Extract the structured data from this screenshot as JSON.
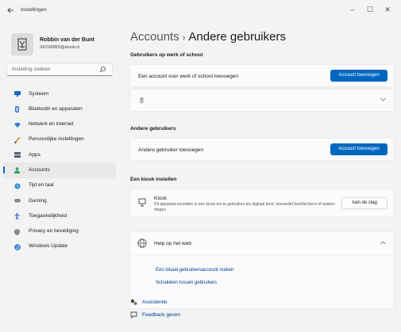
{
  "window": {
    "title": "Instellingen",
    "back_icon": "back-arrow-icon",
    "controls": [
      "–",
      "☐",
      "✕"
    ]
  },
  "profile": {
    "name": "Robbin van der Bunt",
    "email": "SKVSRI800@skvob.nl"
  },
  "search": {
    "placeholder": "Instelling zoeken"
  },
  "sidebar": {
    "items": [
      {
        "label": "Systeem",
        "icon": "monitor-icon",
        "color": "#0f6cbd"
      },
      {
        "label": "Bluetooth en apparaten",
        "icon": "bluetooth-icon",
        "color": "#1f6fd1"
      },
      {
        "label": "Netwerk en internet",
        "icon": "wifi-icon",
        "color": "#2b7bd3"
      },
      {
        "label": "Persoonlijke instellingen",
        "icon": "brush-icon",
        "color": "#e48a2f"
      },
      {
        "label": "Apps",
        "icon": "apps-icon",
        "color": "#52617a"
      },
      {
        "label": "Accounts",
        "icon": "person-icon",
        "color": "#2aa15a",
        "active": true
      },
      {
        "label": "Tijd en taal",
        "icon": "globe-clock-icon",
        "color": "#2d8fd6"
      },
      {
        "label": "Gaming",
        "icon": "gamepad-icon",
        "color": "#8a8a8a"
      },
      {
        "label": "Toegankelijkheid",
        "icon": "accessibility-icon",
        "color": "#1d5fb8"
      },
      {
        "label": "Privacy en beveiliging",
        "icon": "shield-icon",
        "color": "#8c8c8c"
      },
      {
        "label": "Windows Update",
        "icon": "update-icon",
        "color": "#1f78d1"
      }
    ]
  },
  "main": {
    "breadcrumb_parent": "Accounts",
    "breadcrumb_separator": "›",
    "title": "Andere gebruikers",
    "work_school": {
      "heading": "Gebruikers op werk of school",
      "add_text": "Een account voor werk of school toevoegen",
      "add_button": "Account toevoegen"
    },
    "other_users": {
      "heading": "Andere gebruikers",
      "add_text": "Andere gebruiker toevoegen",
      "add_button": "Account toevoegen"
    },
    "kiosk": {
      "heading": "Een kiosk instellen",
      "title": "Kiosk",
      "description": "Dit apparaat omzetten in een kiosk om te gebruiken als digitaal bord, interactief beeldscherm of andere dingen",
      "button": "Aan de slag"
    },
    "help": {
      "title": "Help op het web",
      "links": [
        "Een lokaal gebruikersaccount maken",
        "Schakelen tussen gebruikers"
      ]
    },
    "footer": {
      "assist": "Assistentie",
      "feedback": "Feedback geven"
    }
  },
  "colors": {
    "accent": "#0067c0",
    "link": "#003e92",
    "background": "#f3f3f3",
    "card": "#fbfbfb"
  }
}
